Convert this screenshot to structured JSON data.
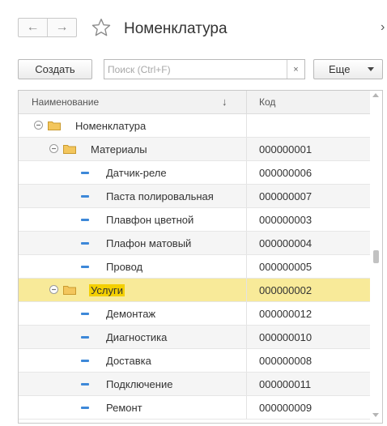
{
  "header": {
    "back_icon": "arrow-left-icon",
    "forward_icon": "arrow-right-icon",
    "favorite_icon": "star-icon",
    "title": "Номенклатура",
    "more_icon": "chevron-right-icon"
  },
  "toolbar": {
    "create_label": "Создать",
    "search_placeholder": "Поиск (Ctrl+F)",
    "search_value": "",
    "clear_label": "×",
    "more_label": "Еще"
  },
  "table": {
    "columns": {
      "name": "Наименование",
      "sort_indicator": "↓",
      "code": "Код"
    },
    "rows": [
      {
        "level": 0,
        "kind": "group",
        "expanded": true,
        "name": "Номенклатура",
        "code": ""
      },
      {
        "level": 1,
        "kind": "group",
        "expanded": true,
        "name": "Материалы",
        "code": "000000001"
      },
      {
        "level": 2,
        "kind": "item",
        "name": "Датчик-реле",
        "code": "000000006"
      },
      {
        "level": 2,
        "kind": "item",
        "name": "Паста полировальная",
        "code": "000000007"
      },
      {
        "level": 2,
        "kind": "item",
        "name": "Плавфон цветной",
        "code": "000000003"
      },
      {
        "level": 2,
        "kind": "item",
        "name": "Плафон матовый",
        "code": "000000004"
      },
      {
        "level": 2,
        "kind": "item",
        "name": "Провод",
        "code": "000000005"
      },
      {
        "level": 1,
        "kind": "group",
        "expanded": true,
        "selected": true,
        "name": "Услуги",
        "code": "000000002"
      },
      {
        "level": 2,
        "kind": "item",
        "name": "Демонтаж",
        "code": "000000012"
      },
      {
        "level": 2,
        "kind": "item",
        "name": "Диагностика",
        "code": "000000010"
      },
      {
        "level": 2,
        "kind": "item",
        "name": "Доставка",
        "code": "000000008"
      },
      {
        "level": 2,
        "kind": "item",
        "name": "Подключение",
        "code": "000000011"
      },
      {
        "level": 2,
        "kind": "item",
        "name": "Ремонт",
        "code": "000000009"
      }
    ]
  },
  "colors": {
    "selected_row": "#f8ea99",
    "selected_highlight": "#f4d000",
    "folder": "#f3c65d",
    "item_marker": "#3d88d8"
  }
}
